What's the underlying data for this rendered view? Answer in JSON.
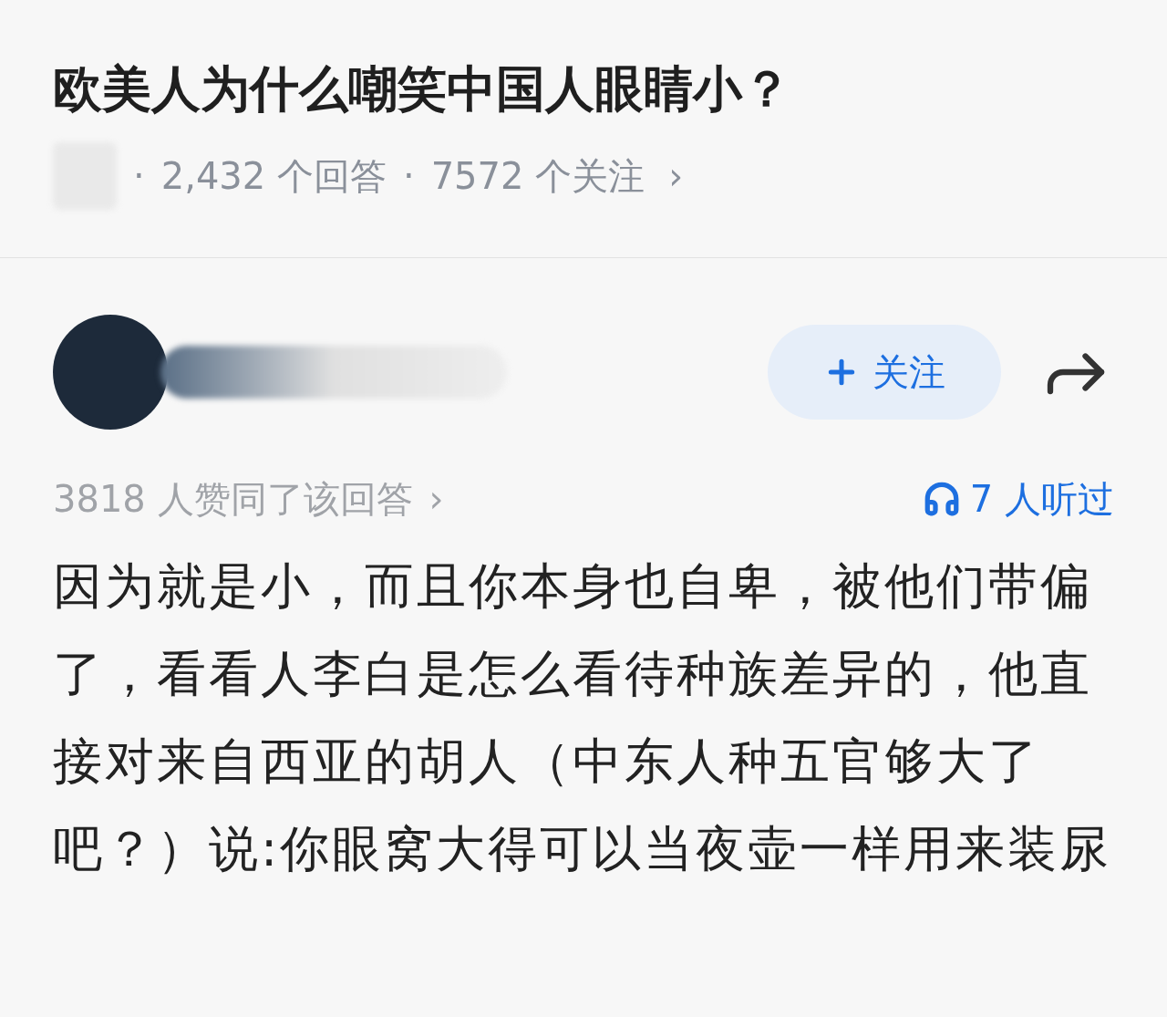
{
  "question": {
    "title": "欧美人为什么嘲笑中国人眼睛小？",
    "separator": "·",
    "stats": [
      "2,432 个回答",
      "7572 个关注"
    ],
    "chevron": "›"
  },
  "answer": {
    "follow_button": {
      "label": "关注"
    },
    "upvotes": "3818 人赞同了该回答",
    "upvotes_chevron": "›",
    "listens": "7 人听过",
    "body": "因为就是小，而且你本身也自卑，被他们带偏了，看看人李白是怎么看待种族差异的，他直接对来自西亚的胡人（中东人种五官够大了吧？）说:你眼窝大得可以当夜壶一样用来装尿"
  }
}
